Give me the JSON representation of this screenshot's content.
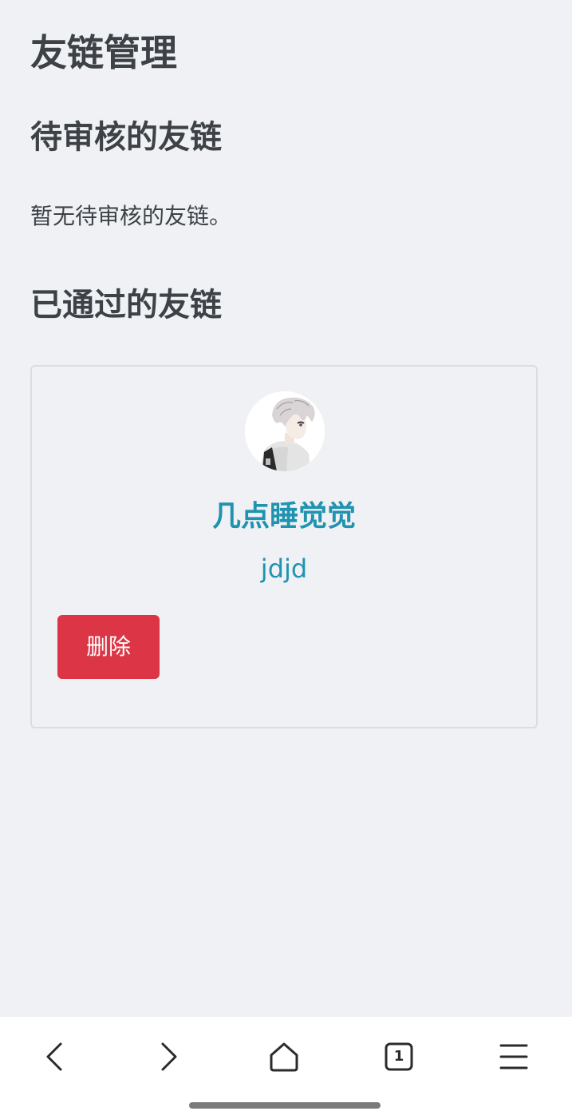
{
  "page": {
    "title": "友链管理"
  },
  "pending": {
    "title": "待审核的友链",
    "empty_text": "暂无待审核的友链。"
  },
  "approved": {
    "title": "已通过的友链",
    "links": [
      {
        "name": "几点睡觉觉",
        "description": "jdjd",
        "delete_label": "删除",
        "avatar_icon": "anime-boy-avatar"
      }
    ]
  },
  "browser_bar": {
    "back_icon": "chevron-left-icon",
    "forward_icon": "chevron-right-icon",
    "home_icon": "home-icon",
    "tab_count": "1",
    "menu_icon": "menu-icon"
  },
  "colors": {
    "background": "#f0f1f5",
    "link": "#1f93b0",
    "danger": "#dc3545",
    "heading": "#3d4246"
  }
}
